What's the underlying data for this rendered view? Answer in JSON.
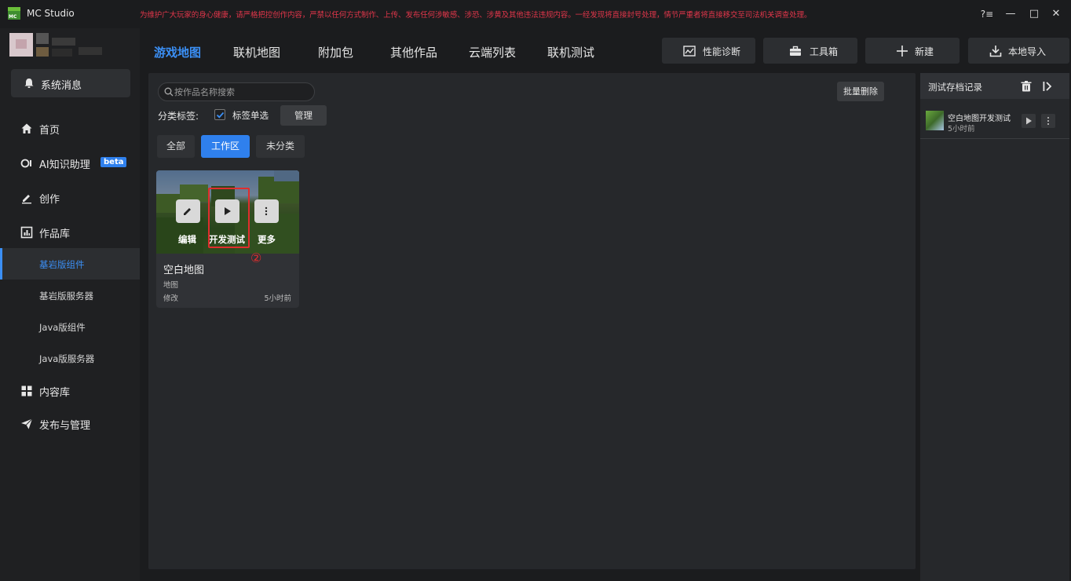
{
  "window": {
    "app_title": "MC Studio",
    "logo_text": "MC",
    "notice": "为维护广大玩家的身心健康，请严格把控创作内容，严禁以任何方式制作、上传、发布任何涉敏感、涉恐、涉黄及其他违法违规内容。一经发现将直接封号处理，情节严重者将直接移交至司法机关调查处理。",
    "controls": {
      "help": "?≡",
      "minimize": "—",
      "maximize": "□",
      "close": "✕"
    }
  },
  "sidebar": {
    "system_message": "系统消息",
    "nav": [
      {
        "label": "首页",
        "icon": "home-icon"
      },
      {
        "label": "AI知识助理",
        "icon": "ai-icon",
        "badge": "beta"
      },
      {
        "label": "创作",
        "icon": "pen-icon"
      },
      {
        "label": "作品库",
        "icon": "library-icon"
      }
    ],
    "sub_items": [
      {
        "label": "基岩版组件",
        "active": true
      },
      {
        "label": "基岩版服务器",
        "active": false
      },
      {
        "label": "Java版组件",
        "active": false
      },
      {
        "label": "Java版服务器",
        "active": false
      }
    ],
    "nav_bottom": [
      {
        "label": "内容库",
        "icon": "grid-icon"
      },
      {
        "label": "发布与管理",
        "icon": "send-icon"
      }
    ]
  },
  "tabs": [
    {
      "label": "游戏地图",
      "active": true
    },
    {
      "label": "联机地图",
      "active": false
    },
    {
      "label": "附加包",
      "active": false
    },
    {
      "label": "其他作品",
      "active": false
    },
    {
      "label": "云端列表",
      "active": false
    },
    {
      "label": "联机测试",
      "active": false
    }
  ],
  "toolbar": {
    "diagnose": "性能诊断",
    "toolbox": "工具箱",
    "new": "新建",
    "import": "本地导入"
  },
  "main": {
    "search_placeholder": "按作品名称搜索",
    "bulk_delete": "批量删除",
    "category_label": "分类标签:",
    "single_select_label": "标签单选",
    "single_select_checked": true,
    "manage": "管理",
    "filters": [
      {
        "label": "全部",
        "active": false
      },
      {
        "label": "工作区",
        "active": true
      },
      {
        "label": "未分类",
        "active": false
      }
    ],
    "card": {
      "title": "空白地图",
      "type": "地图",
      "modified_label": "修改",
      "time": "5小时前",
      "actions": {
        "edit": "编辑",
        "dev_test": "开发测试",
        "more": "更多"
      },
      "step_marker": "②"
    }
  },
  "right_panel": {
    "title": "测试存档记录",
    "records": [
      {
        "name": "空白地图开发测试",
        "time": "5小时前"
      }
    ]
  },
  "colors": {
    "accent": "#3b8ff5",
    "background": "#1b1c1e",
    "panel": "#26282b",
    "notice": "#e0364a",
    "highlight": "#e02d2d"
  }
}
